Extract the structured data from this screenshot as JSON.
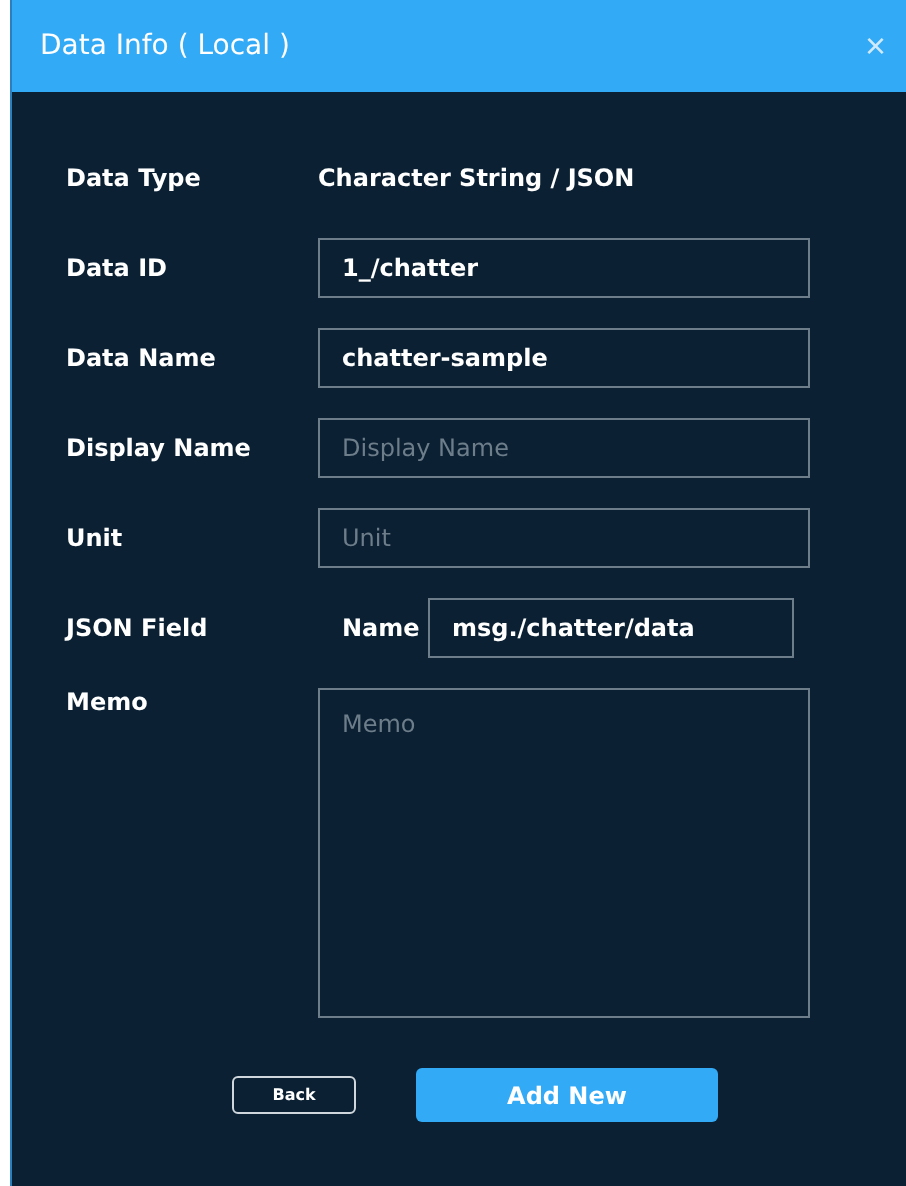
{
  "dialog": {
    "title": "Data Info ( Local )",
    "close": "×"
  },
  "fields": [
    {
      "kind": "text",
      "label": "Data Type",
      "value": "Character String / JSON"
    },
    {
      "kind": "input",
      "label": "Data ID",
      "value": "1_/chatter"
    },
    {
      "kind": "input",
      "label": "Data Name",
      "value": "chatter-sample"
    },
    {
      "kind": "input",
      "label": "Display Name",
      "placeholder": "Display Name"
    },
    {
      "kind": "input",
      "label": "Unit",
      "placeholder": "Unit"
    },
    {
      "kind": "json",
      "label": "JSON Field",
      "sublabel": "Name",
      "value": "msg./chatter/data"
    },
    {
      "kind": "textarea",
      "label": "Memo",
      "placeholder": "Memo"
    }
  ],
  "buttons": {
    "back": "Back",
    "add": "Add New"
  }
}
